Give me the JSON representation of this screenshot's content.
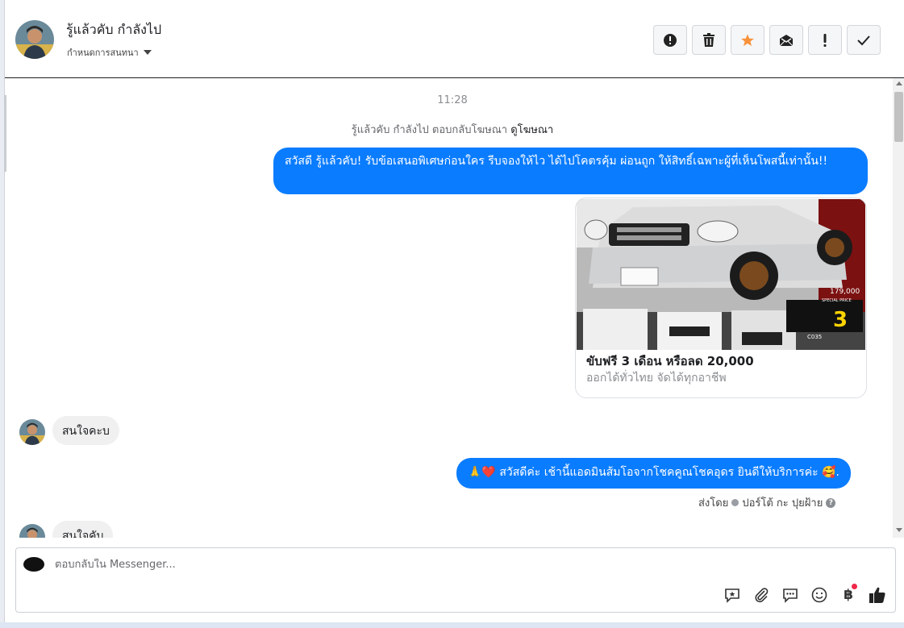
{
  "header": {
    "contact_name": "รู้แล้วคับ กำลังไป",
    "conversation_setting": "กำหนดการสนทนา",
    "actions": [
      {
        "name": "report",
        "icon": "exclamation-circle-icon"
      },
      {
        "name": "delete",
        "icon": "trash-icon"
      },
      {
        "name": "star",
        "icon": "star-icon",
        "color": "#f7923a"
      },
      {
        "name": "mark-unread",
        "icon": "envelope-icon"
      },
      {
        "name": "priority",
        "icon": "exclamation-icon"
      },
      {
        "name": "done",
        "icon": "check-icon"
      }
    ]
  },
  "thread": {
    "timestamp": "11:28",
    "ad_reply_prefix": "รู้แล้วคับ กำลังไป ตอบกลับโฆษณา",
    "ad_reply_link": "ดูโฆษณา",
    "outgoing_message_1": "สวัสดี รู้แล้วคับ! รับข้อเสนอพิเศษก่อนใคร รีบจองให้ไว ได้ไปโคตรคุ้ม ผ่อนถูก ให้สิทธิ์เฉพาะผู้ที่เห็นโพสนี้เท่านั้น!!",
    "ad_card": {
      "title": "ขับฟรี 3 เดือน หรือลด 20,000",
      "subtitle": "ออกได้ทั่วไทย จัดได้ทุกอาชีพ",
      "image_price": "179,000",
      "image_badge": "SPECIAL PRICE",
      "image_months": "3",
      "image_code": "C035"
    },
    "incoming_message_1": "สนใจคะบ",
    "outgoing_message_2": "🙏❤️ สวัสดีค่ะ เช้านี้แอดมินส้มโอจากโชคคูณโชคอุดร ยินดีให้บริการค่ะ 🥰.",
    "sent_by_label": "ส่งโดย",
    "sent_by_name": "ปอร์โต้ กะ ปุยฝ้าย",
    "incoming_message_2": "สนใจคับ"
  },
  "composer": {
    "placeholder": "ตอบกลับใน Messenger...",
    "value": "",
    "tools": [
      "saved-reply-icon",
      "attachment-icon",
      "chat-bubble-icon",
      "emoji-icon",
      "baht-payment-icon",
      "thumbs-up-icon"
    ],
    "baht_symbol": "฿"
  },
  "colors": {
    "outgoing_bubble": "#0a7cff",
    "incoming_bubble": "#f0f0f0",
    "star": "#f7923a",
    "notification_dot": "#f02849"
  }
}
